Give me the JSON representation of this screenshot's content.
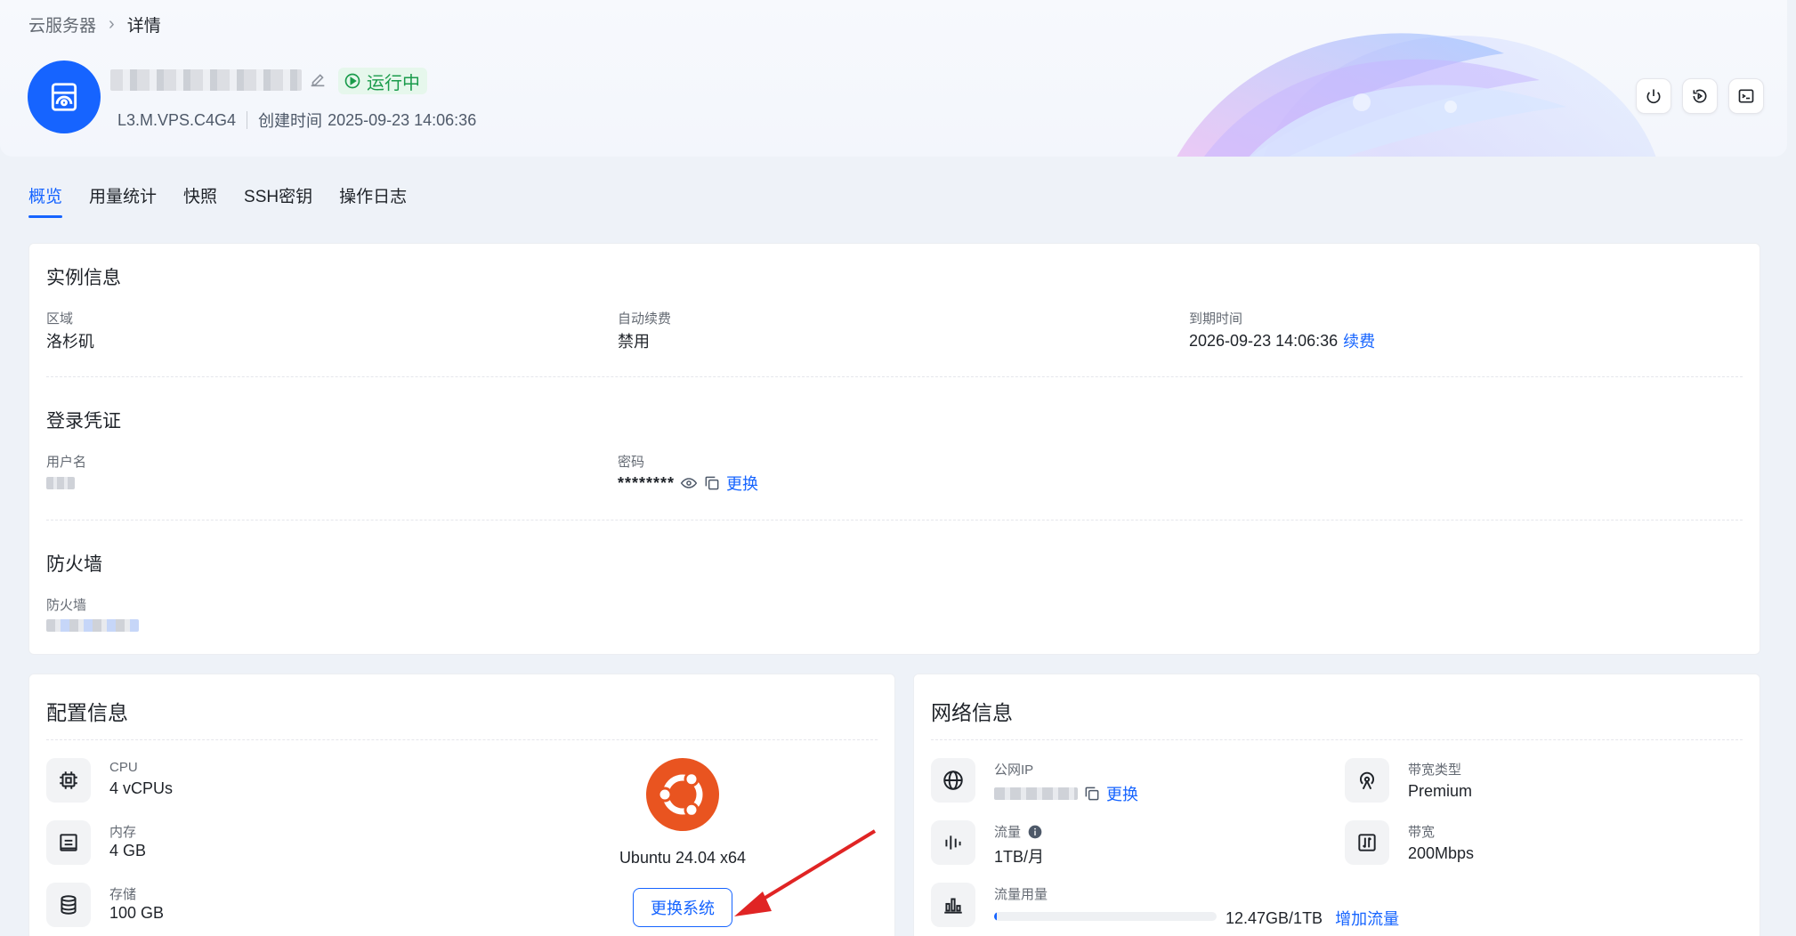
{
  "breadcrumb": {
    "parent": "云服务器",
    "current": "详情"
  },
  "instance": {
    "status": "运行中",
    "plan": "L3.M.VPS.C4G4",
    "created_label": "创建时间",
    "created_time": "2025-09-23 14:06:36"
  },
  "tabs": [
    "概览",
    "用量统计",
    "快照",
    "SSH密钥",
    "操作日志"
  ],
  "instance_info": {
    "title": "实例信息",
    "region_label": "区域",
    "region_value": "洛杉矶",
    "autorenew_label": "自动续费",
    "autorenew_value": "禁用",
    "expire_label": "到期时间",
    "expire_value": "2026-09-23 14:06:36",
    "renew_link": "续费"
  },
  "credentials": {
    "title": "登录凭证",
    "username_label": "用户名",
    "password_label": "密码",
    "password_value": "********",
    "change_link": "更换"
  },
  "firewall": {
    "title": "防火墙",
    "label": "防火墙"
  },
  "config": {
    "title": "配置信息",
    "cpu_label": "CPU",
    "cpu_value": "4 vCPUs",
    "mem_label": "内存",
    "mem_value": "4 GB",
    "disk_label": "存储",
    "disk_value": "100 GB",
    "os_name": "Ubuntu 24.04 x64",
    "change_os_button": "更换系统"
  },
  "network": {
    "title": "网络信息",
    "ip_label": "公网IP",
    "ip_change_link": "更换",
    "bw_type_label": "带宽类型",
    "bw_type_value": "Premium",
    "traffic_label": "流量",
    "traffic_value": "1TB/月",
    "bandwidth_label": "带宽",
    "bandwidth_value": "200Mbps",
    "usage_label": "流量用量",
    "usage_value": "12.47GB/1TB",
    "usage_fraction": 0.0125,
    "add_traffic_link": "增加流量"
  },
  "colors": {
    "primary": "#1664ff",
    "running": "#1a9b4b",
    "ubuntu": "#e95420"
  }
}
